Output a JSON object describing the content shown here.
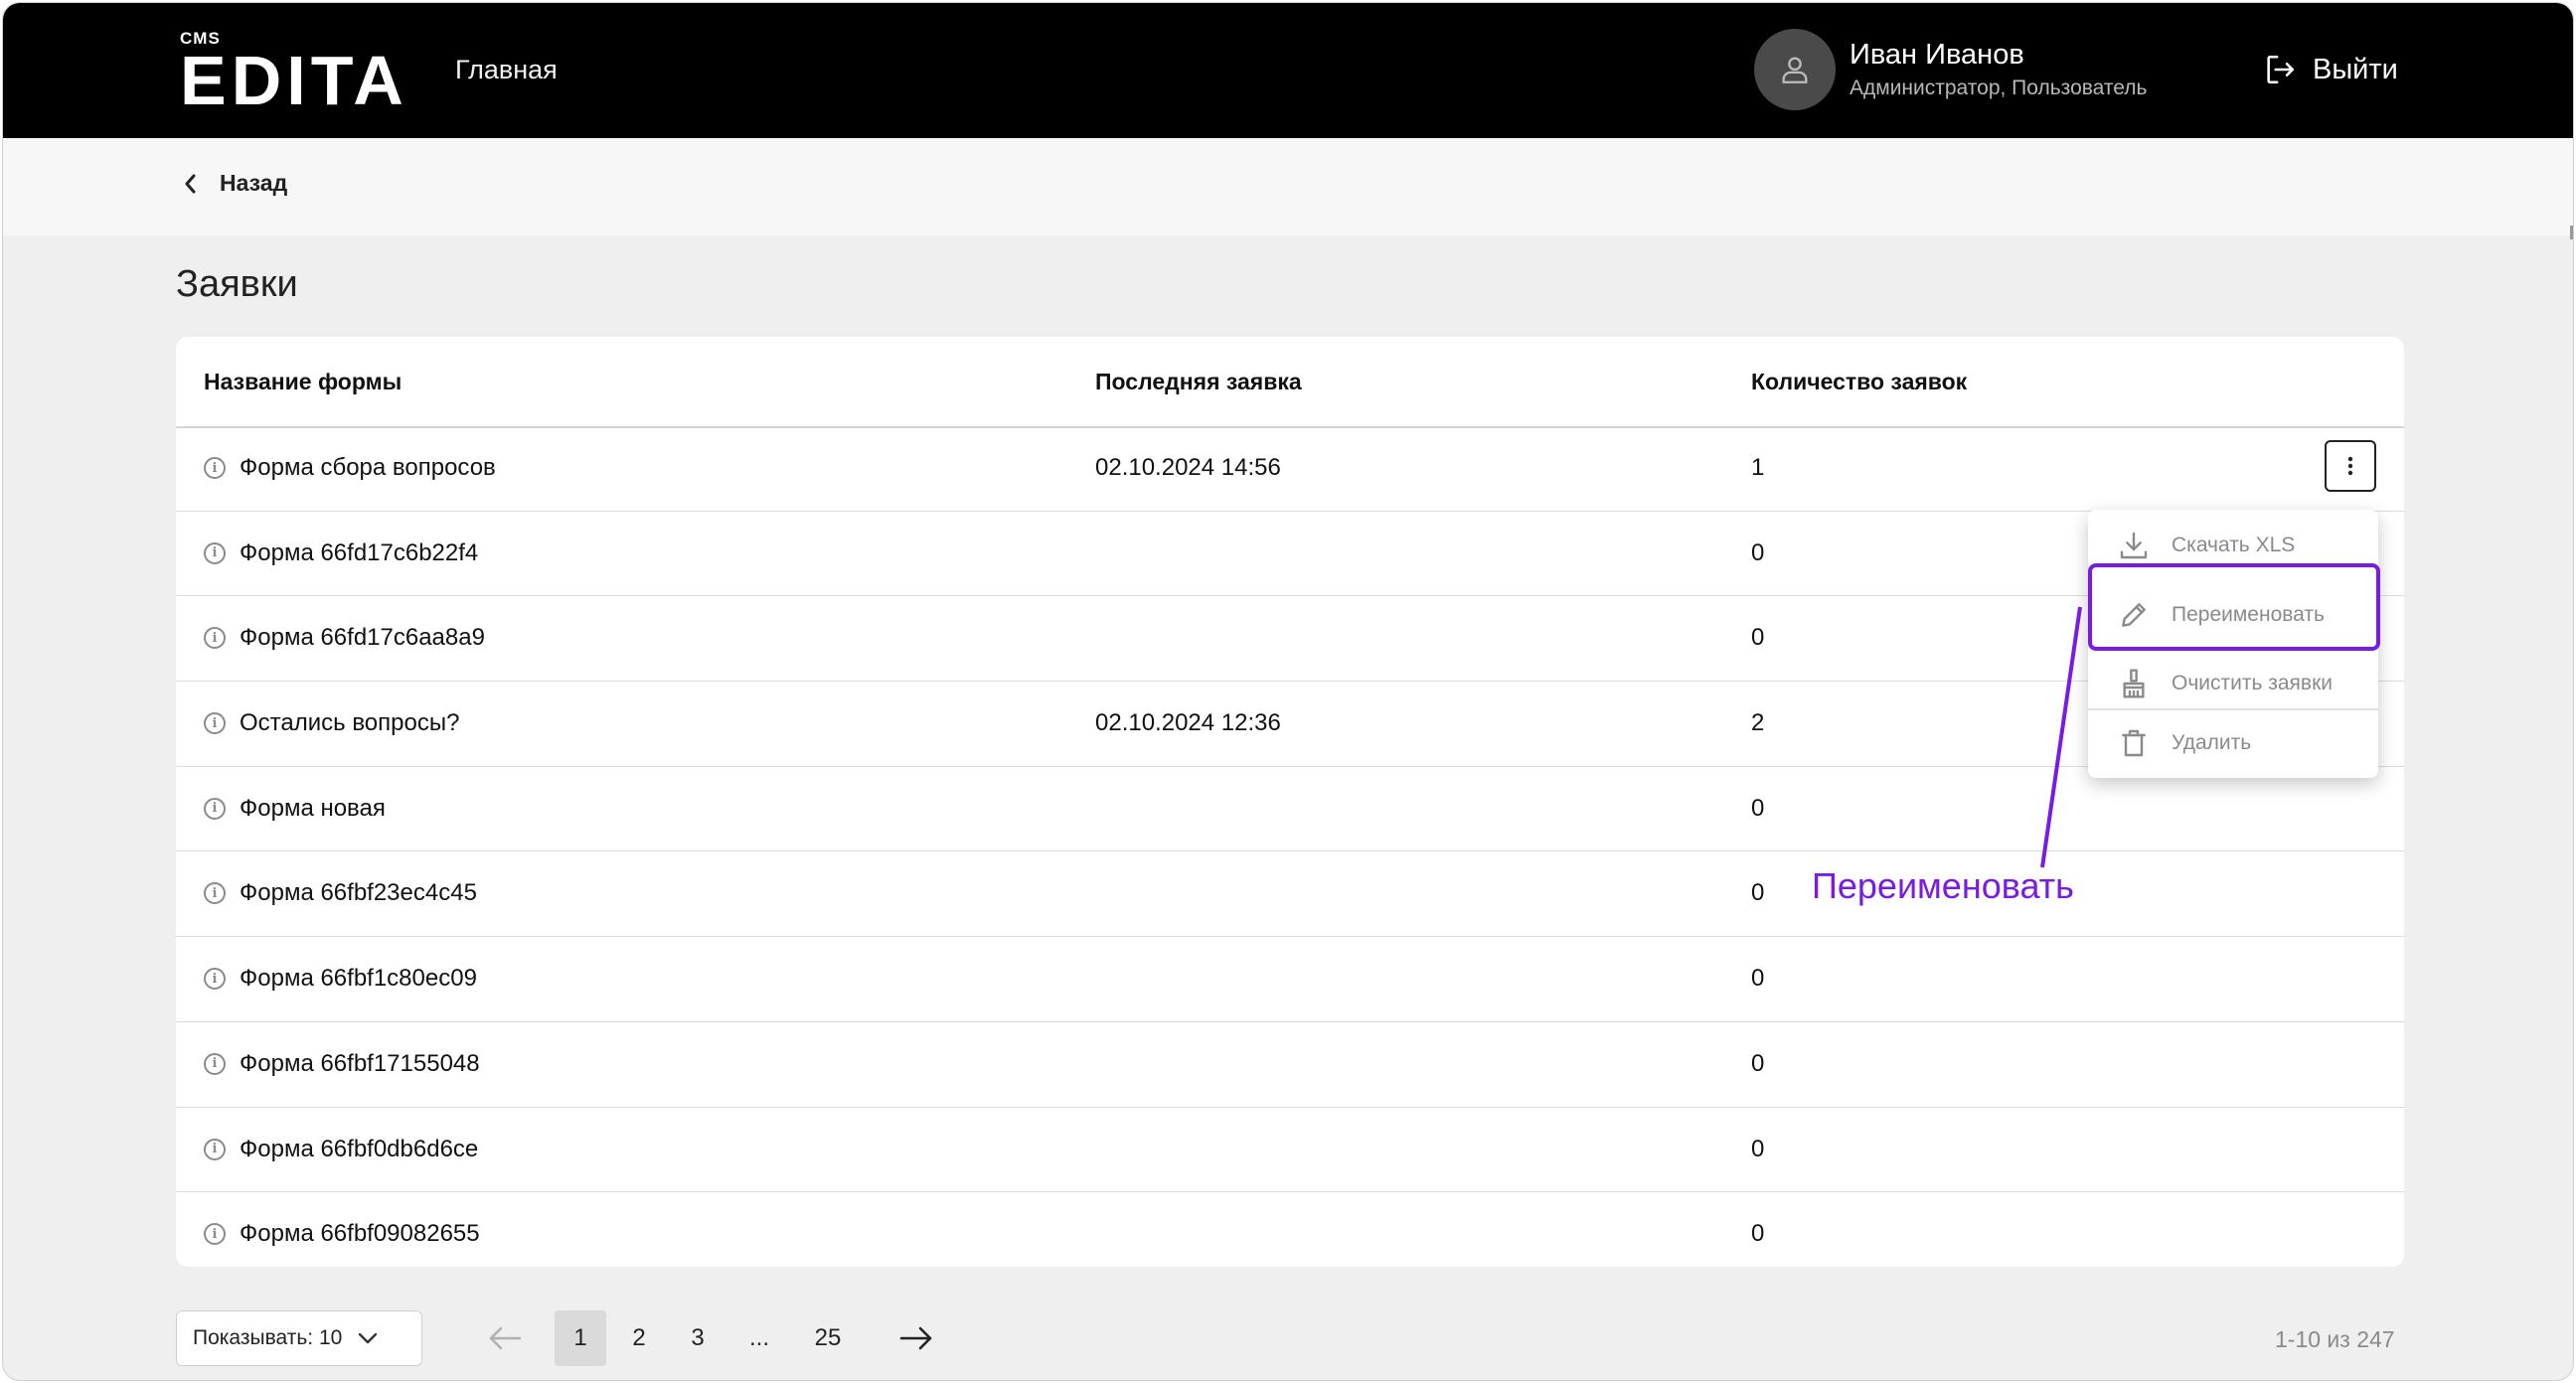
{
  "header": {
    "logo_small": "CMS",
    "logo_main": "EDITA",
    "nav_home": "Главная",
    "user_name": "Иван Иванов",
    "user_role": "Администратор, Пользователь",
    "logout_label": "Выйти"
  },
  "back_label": "Назад",
  "page_title": "Заявки",
  "table": {
    "columns": [
      "Название формы",
      "Последняя заявка",
      "Количество заявок"
    ],
    "rows": [
      {
        "name": "Форма сбора вопросов",
        "last": "02.10.2024 14:56",
        "count": "1"
      },
      {
        "name": "Форма 66fd17c6b22f4",
        "last": "",
        "count": "0"
      },
      {
        "name": "Форма 66fd17c6aa8a9",
        "last": "",
        "count": "0"
      },
      {
        "name": "Остались вопросы?",
        "last": "02.10.2024 12:36",
        "count": "2"
      },
      {
        "name": "Форма новая",
        "last": "",
        "count": "0"
      },
      {
        "name": "Форма 66fbf23ec4c45",
        "last": "",
        "count": "0"
      },
      {
        "name": "Форма 66fbf1c80ec09",
        "last": "",
        "count": "0"
      },
      {
        "name": "Форма 66fbf17155048",
        "last": "",
        "count": "0"
      },
      {
        "name": "Форма 66fbf0db6d6ce",
        "last": "",
        "count": "0"
      },
      {
        "name": "Форма 66fbf09082655",
        "last": "",
        "count": "0"
      }
    ]
  },
  "context_menu": {
    "items": [
      "Скачать XLS",
      "Переименовать",
      "Очистить заявки",
      "Удалить"
    ],
    "highlighted": "Переименовать"
  },
  "callout_label": "Переименовать",
  "pagination": {
    "per_page": "Показывать: 10",
    "pages": [
      "1",
      "2",
      "3",
      "...",
      "25"
    ],
    "current": "1",
    "range": "1-10 из 247"
  },
  "colors": {
    "accent": "#7a1ae6",
    "header_bg": "#000000",
    "page_bg": "#efefef"
  }
}
